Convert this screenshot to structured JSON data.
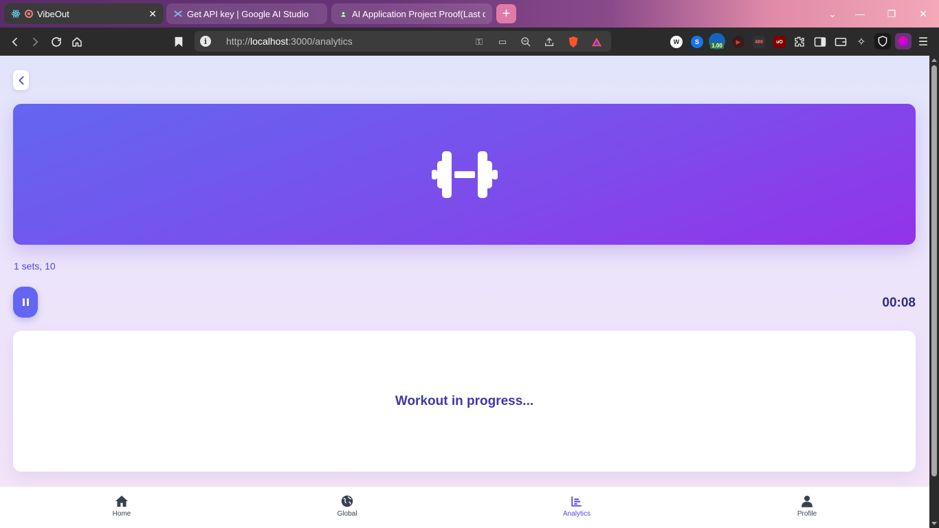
{
  "browser": {
    "tabs": [
      {
        "title": "VibeOut",
        "active": true
      },
      {
        "title": "Get API key | Google AI Studio",
        "active": false
      },
      {
        "title": "AI Application Project Proof(Last da",
        "active": false
      }
    ],
    "new_tab_label": "+",
    "url_host": "localhost",
    "url_prefix": "http://",
    "url_rest": ":3000/analytics",
    "extension_badge": "1.00",
    "extension_480": "480"
  },
  "page": {
    "hero_icon": "dumbbell-icon",
    "sets_text": "1 sets, 10",
    "timer": "00:08",
    "status_message": "Workout in progress...",
    "colors": {
      "accent": "#6366f1",
      "hero_gradient_start": "#6366f1",
      "hero_gradient_end": "#9333ea",
      "heading": "#312e81"
    }
  },
  "bottom_nav": {
    "items": [
      {
        "label": "Home",
        "icon": "home-icon",
        "active": false
      },
      {
        "label": "Global",
        "icon": "globe-icon",
        "active": false
      },
      {
        "label": "Analytics",
        "icon": "analytics-icon",
        "active": true
      },
      {
        "label": "Profile",
        "icon": "profile-icon",
        "active": false
      }
    ]
  }
}
